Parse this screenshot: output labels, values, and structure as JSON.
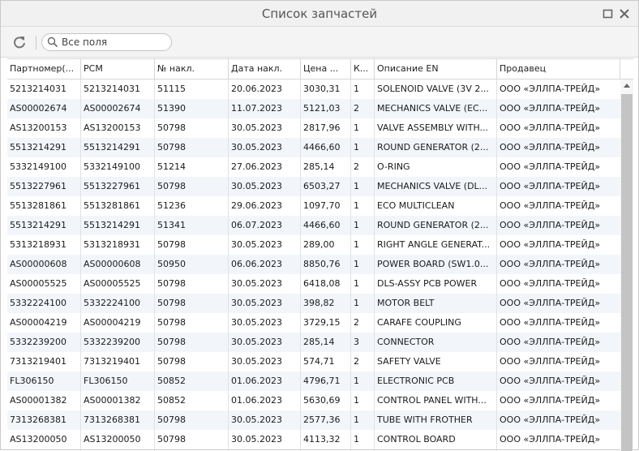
{
  "window": {
    "title": "Список запчастей"
  },
  "toolbar": {
    "search_placeholder": "Все поля"
  },
  "columns": [
    "Партномер(...",
    "PCM",
    "№ накл.",
    "Дата накл.",
    "Цена ...",
    "К...",
    "Описание EN",
    "Продавец"
  ],
  "rows": [
    [
      "5213214031",
      "5213214031",
      "51115",
      "20.06.2023",
      "3030,31",
      "1",
      "SOLENOID VALVE (3V 2...",
      "ООО «ЭЛЛПА-ТРЕЙД»"
    ],
    [
      "AS00002674",
      "AS00002674",
      "51390",
      "11.07.2023",
      "5121,03",
      "2",
      "MECHANICS VALVE (EC...",
      "ООО «ЭЛЛПА-ТРЕЙД»"
    ],
    [
      "AS13200153",
      "AS13200153",
      "50798",
      "30.05.2023",
      "2817,96",
      "1",
      "VALVE ASSEMBLY WITH...",
      "ООО «ЭЛЛПА-ТРЕЙД»"
    ],
    [
      "5513214291",
      "5513214291",
      "50798",
      "30.05.2023",
      "4466,60",
      "1",
      "ROUND GENERATOR (2...",
      "ООО «ЭЛЛПА-ТРЕЙД»"
    ],
    [
      "5332149100",
      "5332149100",
      "51214",
      "27.06.2023",
      "285,14",
      "2",
      "O-RING",
      "ООО «ЭЛЛПА-ТРЕЙД»"
    ],
    [
      "5513227961",
      "5513227961",
      "50798",
      "30.05.2023",
      "6503,27",
      "1",
      "MECHANICS VALVE (DL...",
      "ООО «ЭЛЛПА-ТРЕЙД»"
    ],
    [
      "5513281861",
      "5513281861",
      "51236",
      "29.06.2023",
      "1097,70",
      "1",
      "ECO MULTICLEAN",
      "ООО «ЭЛЛПА-ТРЕЙД»"
    ],
    [
      "5513214291",
      "5513214291",
      "51341",
      "06.07.2023",
      "4466,60",
      "1",
      "ROUND GENERATOR (2...",
      "ООО «ЭЛЛПА-ТРЕЙД»"
    ],
    [
      "5313218931",
      "5313218931",
      "50798",
      "30.05.2023",
      "289,00",
      "1",
      "RIGHT ANGLE GENERAT...",
      "ООО «ЭЛЛПА-ТРЕЙД»"
    ],
    [
      "AS00000608",
      "AS00000608",
      "50950",
      "06.06.2023",
      "8850,76",
      "1",
      "POWER BOARD (SW1.0...",
      "ООО «ЭЛЛПА-ТРЕЙД»"
    ],
    [
      "AS00005525",
      "AS00005525",
      "50798",
      "30.05.2023",
      "6418,08",
      "1",
      "DLS-ASSY PCB POWER",
      "ООО «ЭЛЛПА-ТРЕЙД»"
    ],
    [
      "5332224100",
      "5332224100",
      "50798",
      "30.05.2023",
      "398,82",
      "1",
      "MOTOR BELT",
      "ООО «ЭЛЛПА-ТРЕЙД»"
    ],
    [
      "AS00004219",
      "AS00004219",
      "50798",
      "30.05.2023",
      "3729,15",
      "2",
      "CARAFE COUPLING",
      "ООО «ЭЛЛПА-ТРЕЙД»"
    ],
    [
      "5332239200",
      "5332239200",
      "50798",
      "30.05.2023",
      "285,14",
      "3",
      "CONNECTOR",
      "ООО «ЭЛЛПА-ТРЕЙД»"
    ],
    [
      "7313219401",
      "7313219401",
      "50798",
      "30.05.2023",
      "574,71",
      "2",
      "SAFETY VALVE",
      "ООО «ЭЛЛПА-ТРЕЙД»"
    ],
    [
      "FL306150",
      "FL306150",
      "50852",
      "01.06.2023",
      "4796,71",
      "1",
      "ELECTRONIC PCB",
      "ООО «ЭЛЛПА-ТРЕЙД»"
    ],
    [
      "AS00001382",
      "AS00001382",
      "50852",
      "01.06.2023",
      "5630,69",
      "1",
      "CONTROL PANEL WITH...",
      "ООО «ЭЛЛПА-ТРЕЙД»"
    ],
    [
      "7313268381",
      "7313268381",
      "50798",
      "30.05.2023",
      "2577,36",
      "1",
      "TUBE WITH FROTHER",
      "ООО «ЭЛЛПА-ТРЕЙД»"
    ],
    [
      "AS13200050",
      "AS13200050",
      "50798",
      "30.05.2023",
      "4113,32",
      "1",
      "CONTROL BOARD",
      "ООО «ЭЛЛПА-ТРЕЙД»"
    ]
  ]
}
